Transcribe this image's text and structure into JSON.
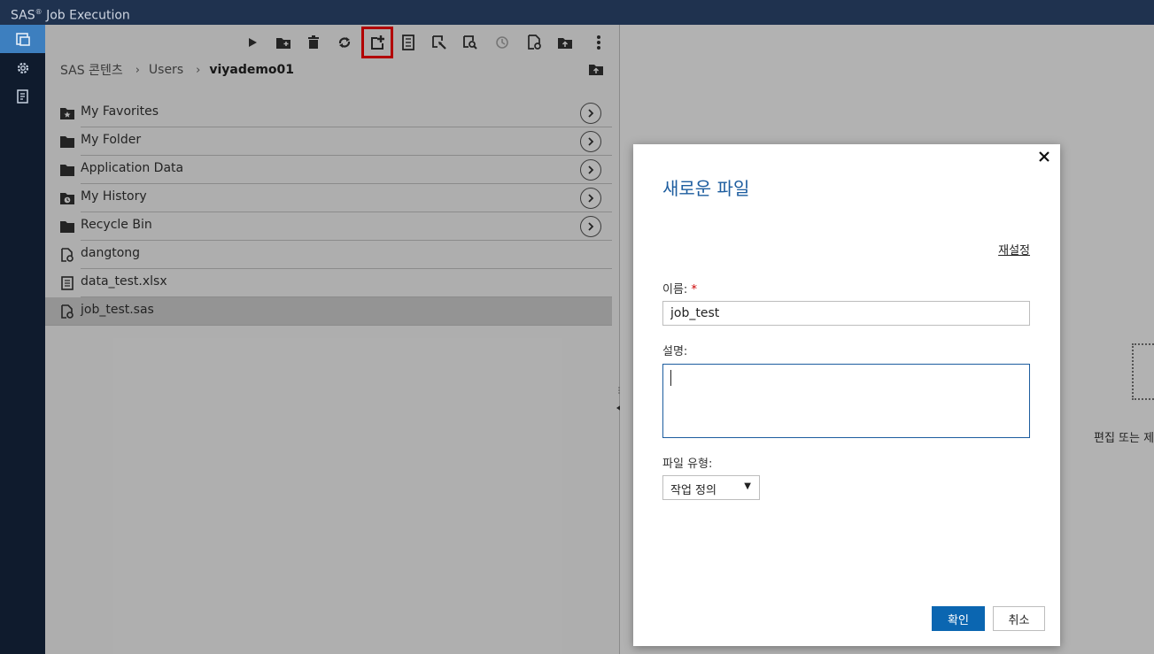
{
  "app": {
    "title_brand": "SAS",
    "title_mark": "®",
    "title_rest": " Job Execution"
  },
  "rail": {
    "items": [
      {
        "icon": "content-icon",
        "active": true
      },
      {
        "icon": "gear-icon",
        "active": false
      },
      {
        "icon": "log-icon",
        "active": false
      }
    ]
  },
  "toolbar": {
    "buttons": [
      "run-icon",
      "new-folder-icon",
      "delete-icon",
      "refresh-icon",
      "new-file-icon",
      "properties-icon",
      "edit-icon",
      "view-icon",
      "history-icon",
      "settings-file-icon",
      "upload-icon",
      "more-icon"
    ],
    "highlighted": "new-file-icon"
  },
  "breadcrumb": {
    "root": "SAS 콘텐츠",
    "sep": "›",
    "mid": "Users",
    "current": "viyademo01"
  },
  "files": [
    {
      "label": "My Favorites",
      "icon": "favorites-folder-icon",
      "nav": true
    },
    {
      "label": "My Folder",
      "icon": "folder-icon",
      "nav": true
    },
    {
      "label": "Application Data",
      "icon": "folder-icon",
      "nav": true
    },
    {
      "label": "My History",
      "icon": "history-folder-icon",
      "nav": true
    },
    {
      "label": "Recycle Bin",
      "icon": "folder-icon",
      "nav": true
    },
    {
      "label": "dangtong",
      "icon": "job-file-icon",
      "nav": false
    },
    {
      "label": "data_test.xlsx",
      "icon": "document-icon",
      "nav": false
    },
    {
      "label": "job_test.sas",
      "icon": "job-file-icon",
      "nav": false,
      "selected": true
    }
  ],
  "right_pane": {
    "placeholder": "편집 또는 제"
  },
  "dialog": {
    "title": "새로운 파일",
    "reset": "재설정",
    "name_label": "이름:",
    "name_required": "*",
    "name_value": "job_test",
    "desc_label": "설명:",
    "type_label": "파일 유형:",
    "type_value": "작업 정의",
    "ok": "확인",
    "cancel": "취소"
  }
}
